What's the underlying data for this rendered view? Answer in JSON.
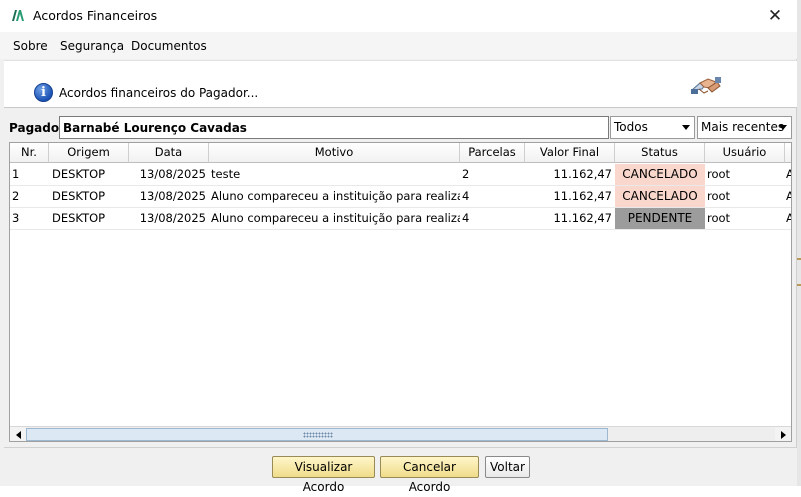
{
  "window": {
    "title": "Acordos Financeiros"
  },
  "menu": {
    "items": [
      "Sobre",
      "Segurança",
      "Documentos"
    ]
  },
  "info": {
    "text": "Acordos financeiros do Pagador..."
  },
  "filter": {
    "label": "Pagador:",
    "pagador_value": "Barnabé Lourenço Cavadas",
    "status_filter": "Todos",
    "order_filter": "Mais recentes"
  },
  "grid": {
    "columns": [
      "Nr.",
      "Origem",
      "Data",
      "Motivo",
      "Parcelas",
      "Valor Final",
      "Status",
      "Usuário"
    ],
    "rows": [
      {
        "nr": "1",
        "origem": "DESKTOP",
        "data": "13/08/2025",
        "motivo": "teste",
        "parcelas": "2",
        "valor": "11.162,47",
        "status": "CANCELADO",
        "usuario": "root",
        "extra": "A"
      },
      {
        "nr": "2",
        "origem": "DESKTOP",
        "data": "13/08/2025",
        "motivo": "Aluno compareceu a instituição para realizar ...",
        "parcelas": "4",
        "valor": "11.162,47",
        "status": "CANCELADO",
        "usuario": "root",
        "extra": "A"
      },
      {
        "nr": "3",
        "origem": "DESKTOP",
        "data": "13/08/2025",
        "motivo": "Aluno compareceu a instituição para realizar ...",
        "parcelas": "4",
        "valor": "11.162,47",
        "status": "PENDENTE",
        "usuario": "root",
        "extra": "A"
      }
    ]
  },
  "buttons": {
    "visualizar": "Visualizar Acordo",
    "cancelar": "Cancelar Acordo",
    "voltar": "Voltar"
  },
  "colors": {
    "status_cancelado": "#f9d7cc",
    "status_pendente": "#9c9c9c",
    "button_accent": "#efdc8a"
  }
}
